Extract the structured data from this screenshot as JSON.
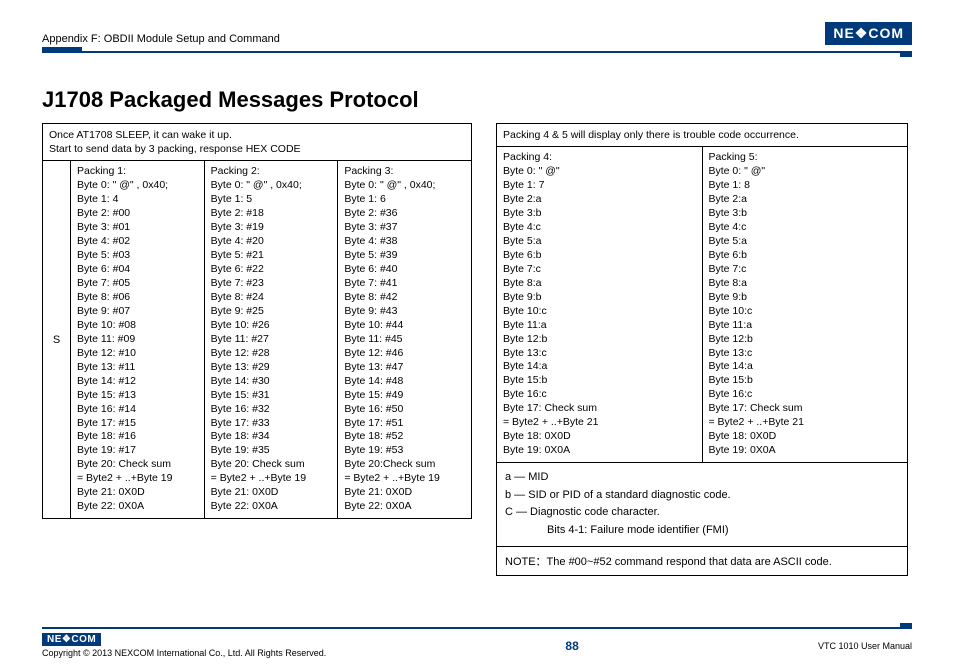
{
  "header": {
    "appendix": "Appendix F: OBDII Module Setup and Command",
    "logo": "NE❖COM"
  },
  "title": "J1708 Packaged Messages Protocol",
  "tableLeft": {
    "intro1": "Once AT1708 SLEEP, it can wake it up.",
    "intro2": "Start to send data by 3 packing, response HEX CODE",
    "sideLabel": "S",
    "cols": [
      [
        "Packing 1:",
        "Byte 0: \" @\" , 0x40;",
        "Byte 1: 4",
        "Byte 2: #00",
        "Byte 3: #01",
        "Byte 4: #02",
        "Byte 5: #03",
        "Byte 6: #04",
        "Byte 7: #05",
        "Byte 8: #06",
        "Byte 9: #07",
        "Byte 10: #08",
        "Byte 11: #09",
        "Byte 12: #10",
        "Byte 13: #11",
        "Byte 14: #12",
        "Byte 15: #13",
        "Byte 16: #14",
        "Byte 17: #15",
        "Byte 18: #16",
        "Byte 19: #17",
        "Byte 20: Check sum",
        "= Byte2 + ..+Byte 19",
        "Byte 21: 0X0D",
        "Byte 22: 0X0A"
      ],
      [
        "Packing 2:",
        "Byte 0: \" @\" , 0x40;",
        "Byte 1: 5",
        "Byte 2: #18",
        "Byte 3: #19",
        "Byte 4: #20",
        "Byte 5: #21",
        "Byte 6: #22",
        "Byte 7: #23",
        "Byte 8: #24",
        "Byte 9: #25",
        "Byte 10: #26",
        "Byte 11: #27",
        "Byte 12: #28",
        "Byte 13: #29",
        "Byte 14: #30",
        "Byte 15: #31",
        "Byte 16: #32",
        "Byte 17: #33",
        "Byte 18: #34",
        "Byte 19: #35",
        "Byte 20: Check sum",
        "= Byte2 + ..+Byte 19",
        "Byte 21: 0X0D",
        "Byte 22: 0X0A"
      ],
      [
        "Packing 3:",
        "Byte 0: \" @\" , 0x40;",
        "Byte 1: 6",
        "Byte 2: #36",
        "Byte 3: #37",
        "Byte 4: #38",
        "Byte 5: #39",
        "Byte 6: #40",
        "Byte 7: #41",
        "Byte 8: #42",
        "Byte 9: #43",
        "Byte 10: #44",
        "Byte 11: #45",
        "Byte 12: #46",
        "Byte 13: #47",
        "Byte 14: #48",
        "Byte 15: #49",
        "Byte 16: #50",
        "Byte 17: #51",
        "Byte 18: #52",
        "Byte 19: #53",
        "Byte 20:Check sum",
        "= Byte2 + ..+Byte 19",
        "Byte 21: 0X0D",
        "Byte 22: 0X0A"
      ]
    ]
  },
  "tableRight": {
    "intro": "Packing 4 & 5 will display only there is trouble code occurrence.",
    "cols": [
      [
        "Packing 4:",
        "Byte 0: \" @\"",
        "Byte 1: 7",
        "Byte 2:a",
        "Byte 3:b",
        "Byte 4:c",
        "Byte 5:a",
        "Byte 6:b",
        "Byte 7:c",
        "Byte 8:a",
        "Byte 9:b",
        "Byte 10:c",
        "Byte 11:a",
        "Byte 12:b",
        "Byte 13:c",
        "Byte 14:a",
        "Byte 15:b",
        "Byte 16:c",
        "Byte 17: Check sum",
        "= Byte2 + ..+Byte 21",
        "Byte 18: 0X0D",
        "Byte 19: 0X0A"
      ],
      [
        "Packing 5:",
        "Byte 0: \" @\"",
        "Byte 1: 8",
        "Byte 2:a",
        "Byte 3:b",
        "Byte 4:c",
        "Byte 5:a",
        "Byte 6:b",
        "Byte 7:c",
        "Byte 8:a",
        "Byte 9:b",
        "Byte 10:c",
        "Byte 11:a",
        "Byte 12:b",
        "Byte 13:c",
        "Byte 14:a",
        "Byte 15:b",
        "Byte 16:c",
        "Byte 17: Check sum",
        "= Byte2 + ..+Byte 21",
        "Byte 18: 0X0D",
        "Byte 19: 0X0A"
      ]
    ],
    "notes": {
      "a": "a — MID",
      "b": "b — SID or PID of a standard diagnostic code.",
      "c": "C — Diagnostic code character.",
      "c2": "Bits 4-1: Failure mode identifier (FMI)"
    },
    "note": "NOTE：The #00~#52 command respond that data are ASCII code."
  },
  "footer": {
    "logo": "NE❖COM",
    "copyright": "Copyright © 2013 NEXCOM International Co., Ltd. All Rights Reserved.",
    "page": "88",
    "manual": "VTC 1010 User Manual"
  }
}
